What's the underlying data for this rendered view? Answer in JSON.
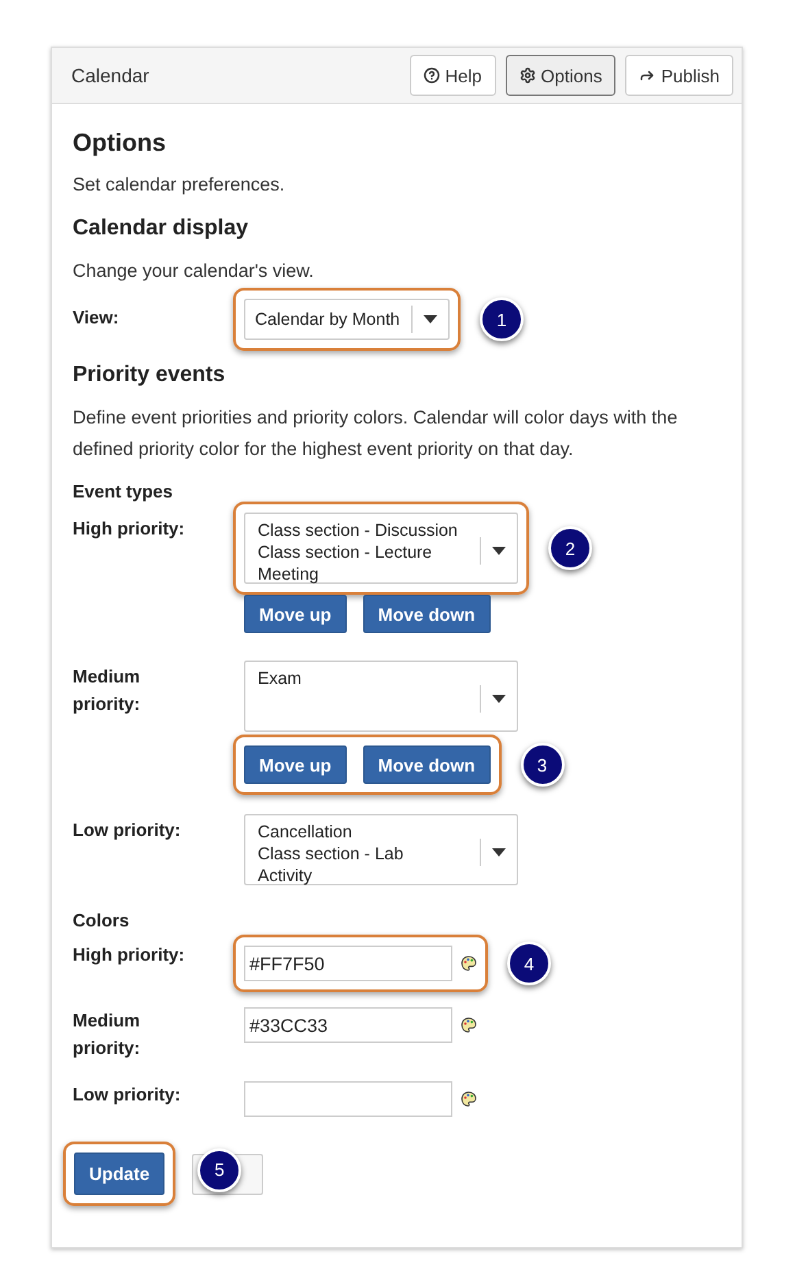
{
  "header": {
    "title": "Calendar",
    "buttons": [
      {
        "label": "Help",
        "selected": false
      },
      {
        "label": "Options",
        "selected": true
      },
      {
        "label": "Publish",
        "selected": false
      }
    ]
  },
  "page": {
    "title": "Options",
    "intro": "Set calendar preferences."
  },
  "display": {
    "heading": "Calendar display",
    "description": "Change your calendar's view.",
    "view": {
      "label": "View:",
      "value": "Calendar by Month",
      "highlighted": true,
      "callout": "1"
    }
  },
  "priority": {
    "heading": "Priority events",
    "description": "Define event priorities and priority colors. Calendar will color days with the defined priority color for the highest event priority on that day.",
    "event_types_heading": "Event types",
    "groups": [
      {
        "label": "High priority:",
        "items": [
          "Class section - Discussion",
          "Class section - Lecture",
          "Meeting"
        ],
        "list_highlighted": true,
        "list_callout": "2",
        "buttons": [
          "Move up",
          "Move down"
        ]
      },
      {
        "label": "Medium priority:",
        "items": [
          "Exam"
        ],
        "list_highlighted": false,
        "buttons": [
          "Move up",
          "Move down"
        ],
        "buttons_highlighted": true,
        "buttons_callout": "3"
      },
      {
        "label": "Low priority:",
        "items": [
          "Cancellation",
          "Class section - Lab",
          "Activity"
        ],
        "list_highlighted": false
      }
    ],
    "colors_heading": "Colors",
    "colors": [
      {
        "label": "High priority:",
        "value": "#FF7F50",
        "highlighted": true,
        "callout": "4"
      },
      {
        "label": "Medium priority:",
        "value": "#33CC33",
        "highlighted": false
      },
      {
        "label": "Low priority:",
        "highlighted": false
      }
    ]
  },
  "actions": [
    {
      "kind": "primary",
      "label": "Update",
      "highlighted": true
    },
    {
      "kind": "secondary",
      "highlighted": false,
      "callout": "5"
    }
  ]
}
